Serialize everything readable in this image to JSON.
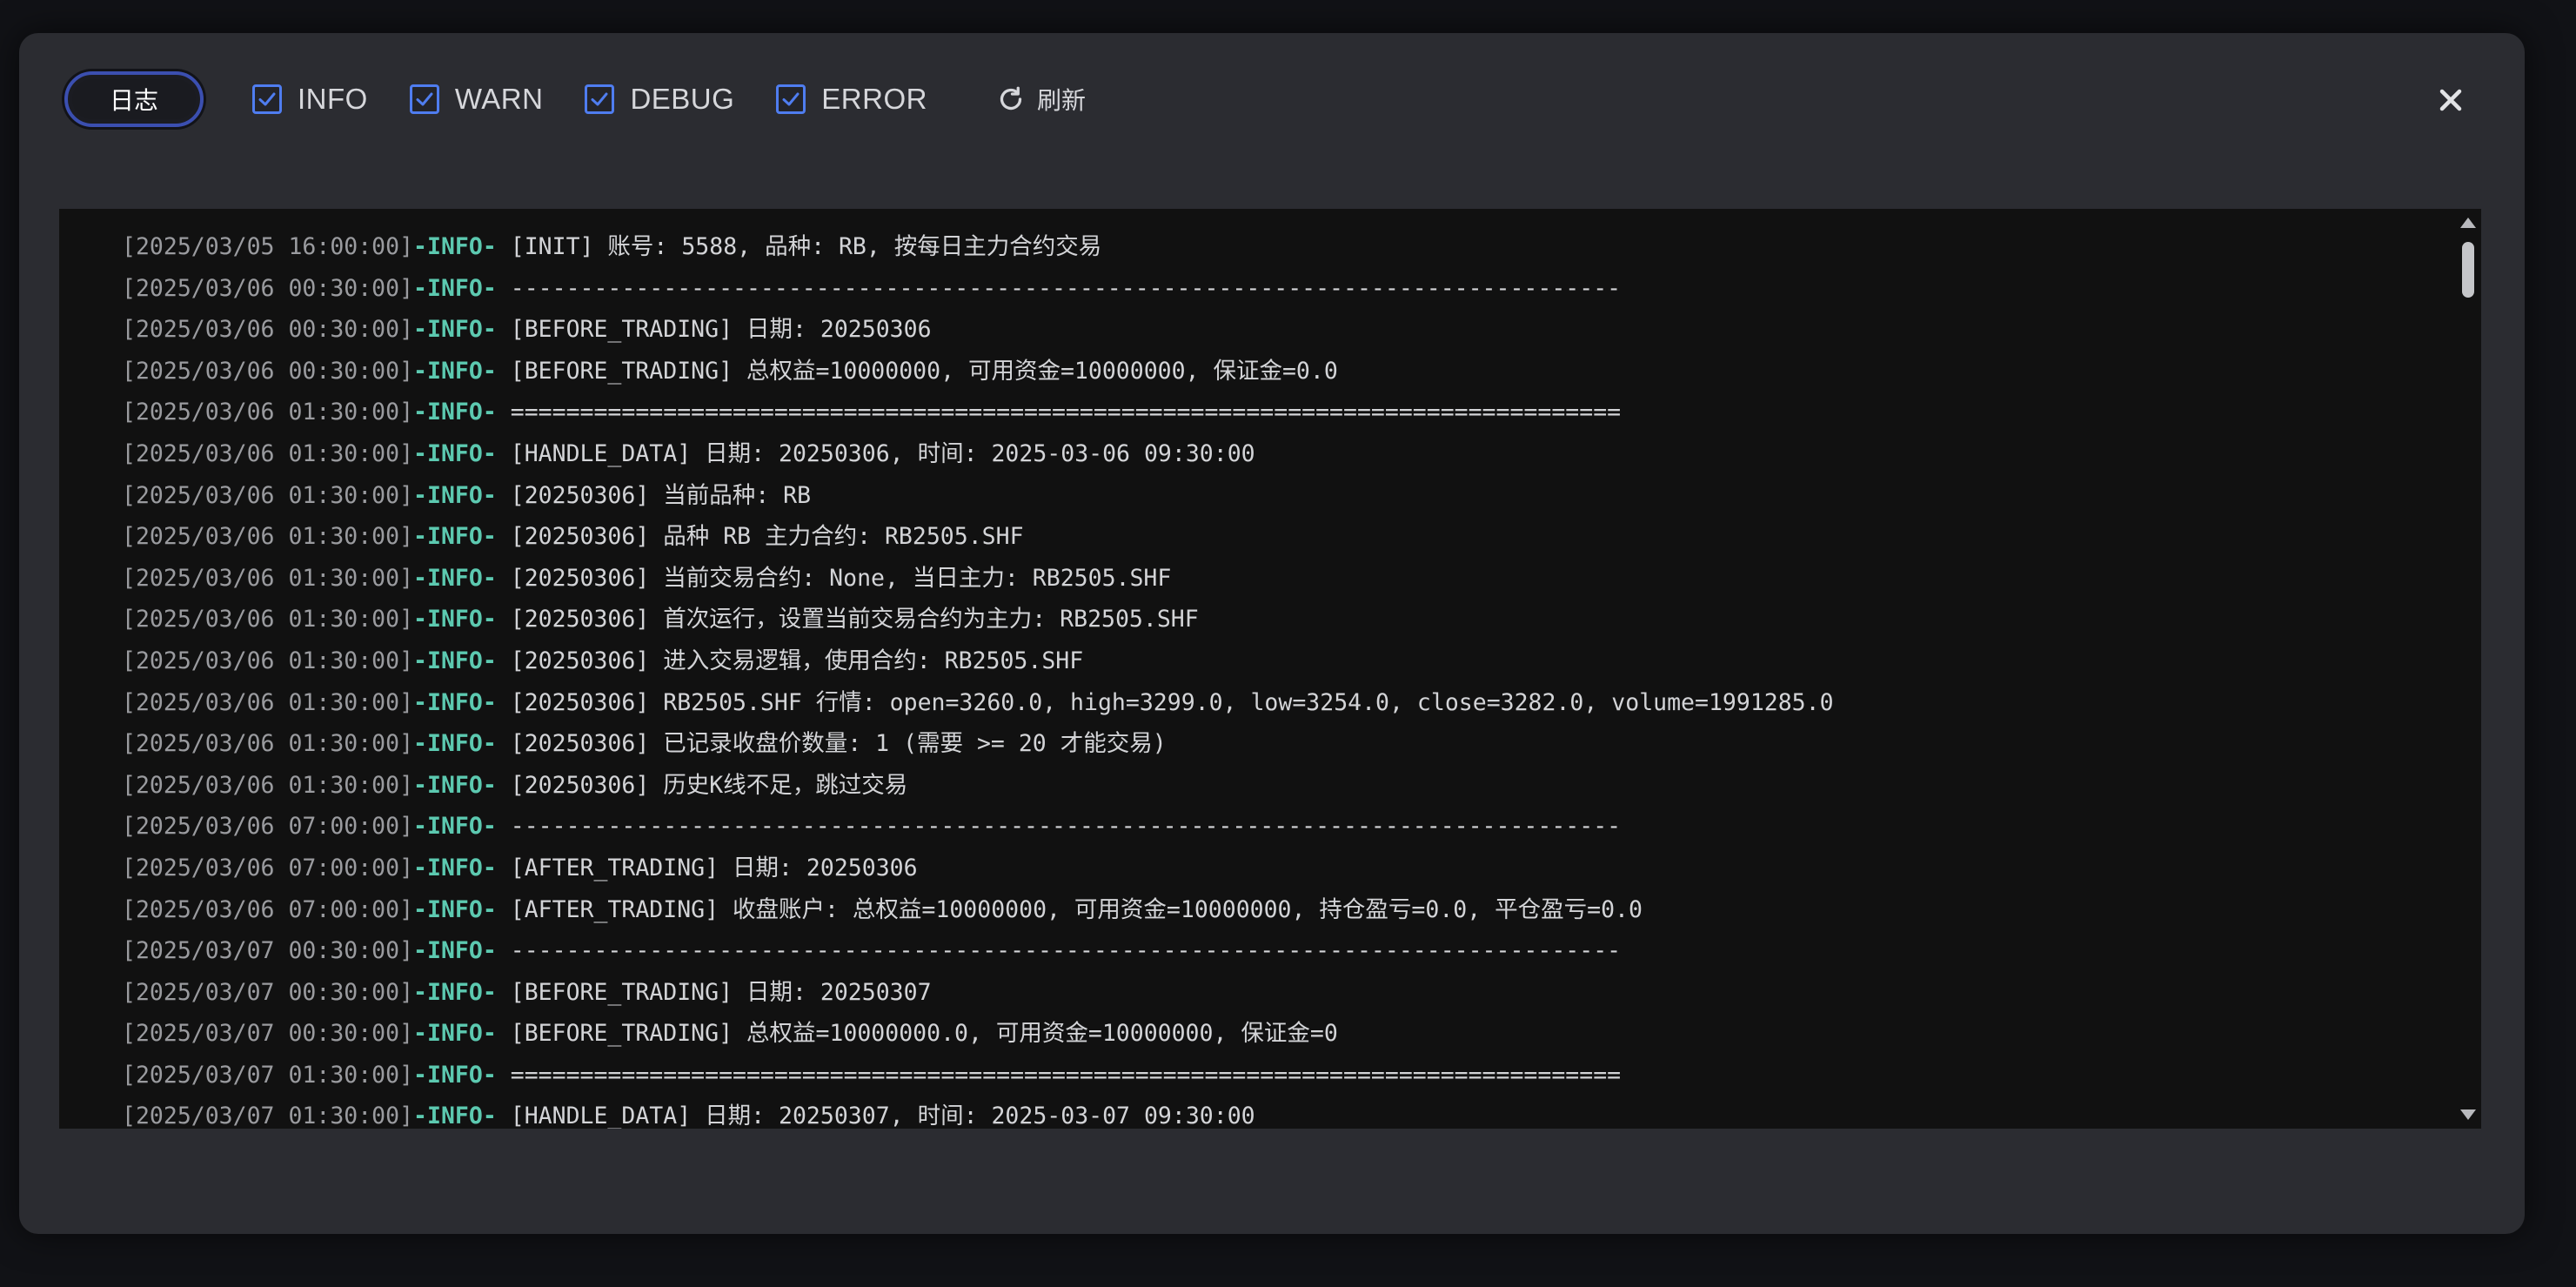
{
  "toolbar": {
    "log_button": "日志",
    "filters": [
      {
        "label": "INFO",
        "checked": true
      },
      {
        "label": "WARN",
        "checked": true
      },
      {
        "label": "DEBUG",
        "checked": true
      },
      {
        "label": "ERROR",
        "checked": true
      }
    ],
    "refresh_label": "刷新"
  },
  "colors": {
    "accent": "#4f7df0",
    "level_info": "#5cc9b0",
    "panel_bg": "#111111",
    "modal_bg": "#2b2c31"
  },
  "log": {
    "lines": [
      {
        "ts": "[2025/03/05 16:00:00]",
        "level": "-INFO-",
        "msg": "[INIT] 账号: 5588, 品种: RB, 按每日主力合约交易"
      },
      {
        "ts": "[2025/03/06 00:30:00]",
        "level": "-INFO-",
        "msg": "--------------------------------------------------------------------------------"
      },
      {
        "ts": "[2025/03/06 00:30:00]",
        "level": "-INFO-",
        "msg": "[BEFORE_TRADING] 日期: 20250306"
      },
      {
        "ts": "[2025/03/06 00:30:00]",
        "level": "-INFO-",
        "msg": "[BEFORE_TRADING] 总权益=10000000, 可用资金=10000000, 保证金=0.0"
      },
      {
        "ts": "[2025/03/06 01:30:00]",
        "level": "-INFO-",
        "msg": "================================================================================"
      },
      {
        "ts": "[2025/03/06 01:30:00]",
        "level": "-INFO-",
        "msg": "[HANDLE_DATA] 日期: 20250306, 时间: 2025-03-06 09:30:00"
      },
      {
        "ts": "[2025/03/06 01:30:00]",
        "level": "-INFO-",
        "msg": "[20250306] 当前品种: RB"
      },
      {
        "ts": "[2025/03/06 01:30:00]",
        "level": "-INFO-",
        "msg": "[20250306] 品种 RB 主力合约: RB2505.SHF"
      },
      {
        "ts": "[2025/03/06 01:30:00]",
        "level": "-INFO-",
        "msg": "[20250306] 当前交易合约: None, 当日主力: RB2505.SHF"
      },
      {
        "ts": "[2025/03/06 01:30:00]",
        "level": "-INFO-",
        "msg": "[20250306] 首次运行，设置当前交易合约为主力: RB2505.SHF"
      },
      {
        "ts": "[2025/03/06 01:30:00]",
        "level": "-INFO-",
        "msg": "[20250306] 进入交易逻辑，使用合约: RB2505.SHF"
      },
      {
        "ts": "[2025/03/06 01:30:00]",
        "level": "-INFO-",
        "msg": "[20250306] RB2505.SHF 行情: open=3260.0, high=3299.0, low=3254.0, close=3282.0, volume=1991285.0"
      },
      {
        "ts": "[2025/03/06 01:30:00]",
        "level": "-INFO-",
        "msg": "[20250306] 已记录收盘价数量: 1 (需要 >= 20 才能交易)"
      },
      {
        "ts": "[2025/03/06 01:30:00]",
        "level": "-INFO-",
        "msg": "[20250306] 历史K线不足，跳过交易"
      },
      {
        "ts": "[2025/03/06 07:00:00]",
        "level": "-INFO-",
        "msg": "--------------------------------------------------------------------------------"
      },
      {
        "ts": "[2025/03/06 07:00:00]",
        "level": "-INFO-",
        "msg": "[AFTER_TRADING] 日期: 20250306"
      },
      {
        "ts": "[2025/03/06 07:00:00]",
        "level": "-INFO-",
        "msg": "[AFTER_TRADING] 收盘账户: 总权益=10000000, 可用资金=10000000, 持仓盈亏=0.0, 平仓盈亏=0.0"
      },
      {
        "ts": "[2025/03/07 00:30:00]",
        "level": "-INFO-",
        "msg": "--------------------------------------------------------------------------------"
      },
      {
        "ts": "[2025/03/07 00:30:00]",
        "level": "-INFO-",
        "msg": "[BEFORE_TRADING] 日期: 20250307"
      },
      {
        "ts": "[2025/03/07 00:30:00]",
        "level": "-INFO-",
        "msg": "[BEFORE_TRADING] 总权益=10000000.0, 可用资金=10000000, 保证金=0"
      },
      {
        "ts": "[2025/03/07 01:30:00]",
        "level": "-INFO-",
        "msg": "================================================================================"
      },
      {
        "ts": "[2025/03/07 01:30:00]",
        "level": "-INFO-",
        "msg": "[HANDLE_DATA] 日期: 20250307, 时间: 2025-03-07 09:30:00"
      }
    ]
  }
}
